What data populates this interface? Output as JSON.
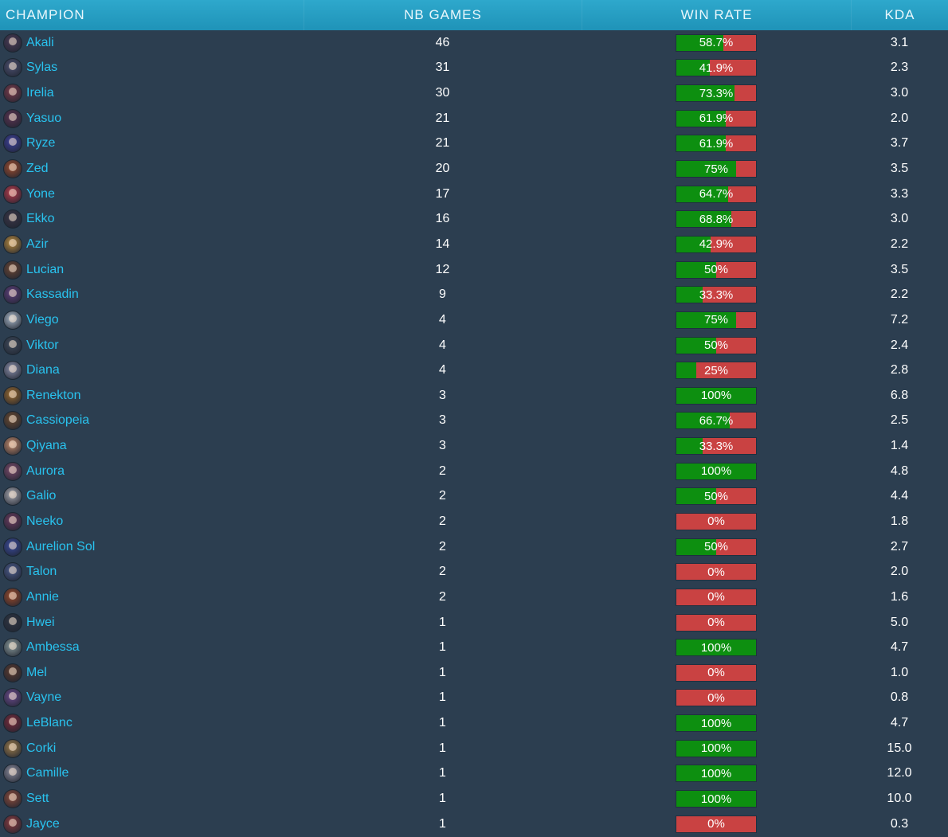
{
  "headers": {
    "champion": "CHAMPION",
    "games": "NB GAMES",
    "winrate": "WIN RATE",
    "kda": "KDA"
  },
  "colors": {
    "header_bg": "#2ea8cc",
    "body_bg": "#2c3e50",
    "name": "#29c3ef",
    "win": "#0d8f10",
    "loss": "#c94242"
  },
  "rows": [
    {
      "name": "Akali",
      "games": "46",
      "winrate_label": "58.7%",
      "winrate": 58.7,
      "kda": "3.1",
      "icon": "akali-portrait-icon",
      "color": "#4a3a55"
    },
    {
      "name": "Sylas",
      "games": "31",
      "winrate_label": "41.9%",
      "winrate": 41.9,
      "kda": "2.3",
      "icon": "sylas-portrait-icon",
      "color": "#4c4f6e"
    },
    {
      "name": "Irelia",
      "games": "30",
      "winrate_label": "73.3%",
      "winrate": 73.3,
      "kda": "3.0",
      "icon": "irelia-portrait-icon",
      "color": "#7a3a4a"
    },
    {
      "name": "Yasuo",
      "games": "21",
      "winrate_label": "61.9%",
      "winrate": 61.9,
      "kda": "2.0",
      "icon": "yasuo-portrait-icon",
      "color": "#5a3350"
    },
    {
      "name": "Ryze",
      "games": "21",
      "winrate_label": "61.9%",
      "winrate": 61.9,
      "kda": "3.7",
      "icon": "ryze-portrait-icon",
      "color": "#3c3f9a"
    },
    {
      "name": "Zed",
      "games": "20",
      "winrate_label": "75%",
      "winrate": 75,
      "kda": "3.5",
      "icon": "zed-portrait-icon",
      "color": "#9a4b2e"
    },
    {
      "name": "Yone",
      "games": "17",
      "winrate_label": "64.7%",
      "winrate": 64.7,
      "kda": "3.3",
      "icon": "yone-portrait-icon",
      "color": "#b83a4a"
    },
    {
      "name": "Ekko",
      "games": "16",
      "winrate_label": "68.8%",
      "winrate": 68.8,
      "kda": "3.0",
      "icon": "ekko-portrait-icon",
      "color": "#3a3545"
    },
    {
      "name": "Azir",
      "games": "14",
      "winrate_label": "42.9%",
      "winrate": 42.9,
      "kda": "2.2",
      "icon": "azir-portrait-icon",
      "color": "#b88a3e"
    },
    {
      "name": "Lucian",
      "games": "12",
      "winrate_label": "50%",
      "winrate": 50,
      "kda": "3.5",
      "icon": "lucian-portrait-icon",
      "color": "#6a4634"
    },
    {
      "name": "Kassadin",
      "games": "9",
      "winrate_label": "33.3%",
      "winrate": 33.3,
      "kda": "2.2",
      "icon": "kassadin-portrait-icon",
      "color": "#5e3f7a"
    },
    {
      "name": "Viego",
      "games": "4",
      "winrate_label": "75%",
      "winrate": 75,
      "kda": "7.2",
      "icon": "viego-portrait-icon",
      "color": "#aab8c8"
    },
    {
      "name": "Viktor",
      "games": "4",
      "winrate_label": "50%",
      "winrate": 50,
      "kda": "2.4",
      "icon": "viktor-portrait-icon",
      "color": "#3f4a5a"
    },
    {
      "name": "Diana",
      "games": "4",
      "winrate_label": "25%",
      "winrate": 25,
      "kda": "2.8",
      "icon": "diana-portrait-icon",
      "color": "#8a8ea8"
    },
    {
      "name": "Renekton",
      "games": "3",
      "winrate_label": "100%",
      "winrate": 100,
      "kda": "6.8",
      "icon": "renekton-portrait-icon",
      "color": "#9a6a2e"
    },
    {
      "name": "Cassiopeia",
      "games": "3",
      "winrate_label": "66.7%",
      "winrate": 66.7,
      "kda": "2.5",
      "icon": "cassiopeia-portrait-icon",
      "color": "#6a4a30"
    },
    {
      "name": "Qiyana",
      "games": "3",
      "winrate_label": "33.3%",
      "winrate": 33.3,
      "kda": "1.4",
      "icon": "qiyana-portrait-icon",
      "color": "#c48a6a"
    },
    {
      "name": "Aurora",
      "games": "2",
      "winrate_label": "100%",
      "winrate": 100,
      "kda": "4.8",
      "icon": "aurora-portrait-icon",
      "color": "#7a4a6a"
    },
    {
      "name": "Galio",
      "games": "2",
      "winrate_label": "50%",
      "winrate": 50,
      "kda": "4.4",
      "icon": "galio-portrait-icon",
      "color": "#a8a8b0"
    },
    {
      "name": "Neeko",
      "games": "2",
      "winrate_label": "0%",
      "winrate": 0,
      "kda": "1.8",
      "icon": "neeko-portrait-icon",
      "color": "#6a3a5e"
    },
    {
      "name": "Aurelion Sol",
      "games": "2",
      "winrate_label": "50%",
      "winrate": 50,
      "kda": "2.7",
      "icon": "aurelion-sol-portrait-icon",
      "color": "#3a4a9a"
    },
    {
      "name": "Talon",
      "games": "2",
      "winrate_label": "0%",
      "winrate": 0,
      "kda": "2.0",
      "icon": "talon-portrait-icon",
      "color": "#4a5a8a"
    },
    {
      "name": "Annie",
      "games": "2",
      "winrate_label": "0%",
      "winrate": 0,
      "kda": "1.6",
      "icon": "annie-portrait-icon",
      "color": "#9a4a2a"
    },
    {
      "name": "Hwei",
      "games": "1",
      "winrate_label": "0%",
      "winrate": 0,
      "kda": "5.0",
      "icon": "hwei-portrait-icon",
      "color": "#2f3542"
    },
    {
      "name": "Ambessa",
      "games": "1",
      "winrate_label": "100%",
      "winrate": 100,
      "kda": "4.7",
      "icon": "ambessa-portrait-icon",
      "color": "#8a9a9a"
    },
    {
      "name": "Mel",
      "games": "1",
      "winrate_label": "0%",
      "winrate": 0,
      "kda": "1.0",
      "icon": "mel-portrait-icon",
      "color": "#5a3a2e"
    },
    {
      "name": "Vayne",
      "games": "1",
      "winrate_label": "0%",
      "winrate": 0,
      "kda": "0.8",
      "icon": "vayne-portrait-icon",
      "color": "#6a4a8a"
    },
    {
      "name": "LeBlanc",
      "games": "1",
      "winrate_label": "100%",
      "winrate": 100,
      "kda": "4.7",
      "icon": "leblanc-portrait-icon",
      "color": "#7a2a3a"
    },
    {
      "name": "Corki",
      "games": "1",
      "winrate_label": "100%",
      "winrate": 100,
      "kda": "15.0",
      "icon": "corki-portrait-icon",
      "color": "#9a7a4a"
    },
    {
      "name": "Camille",
      "games": "1",
      "winrate_label": "100%",
      "winrate": 100,
      "kda": "12.0",
      "icon": "camille-portrait-icon",
      "color": "#8a8a9a"
    },
    {
      "name": "Sett",
      "games": "1",
      "winrate_label": "100%",
      "winrate": 100,
      "kda": "10.0",
      "icon": "sett-portrait-icon",
      "color": "#8a4a3a"
    },
    {
      "name": "Jayce",
      "games": "1",
      "winrate_label": "0%",
      "winrate": 0,
      "kda": "0.3",
      "icon": "jayce-portrait-icon",
      "color": "#8a3a3e"
    }
  ]
}
